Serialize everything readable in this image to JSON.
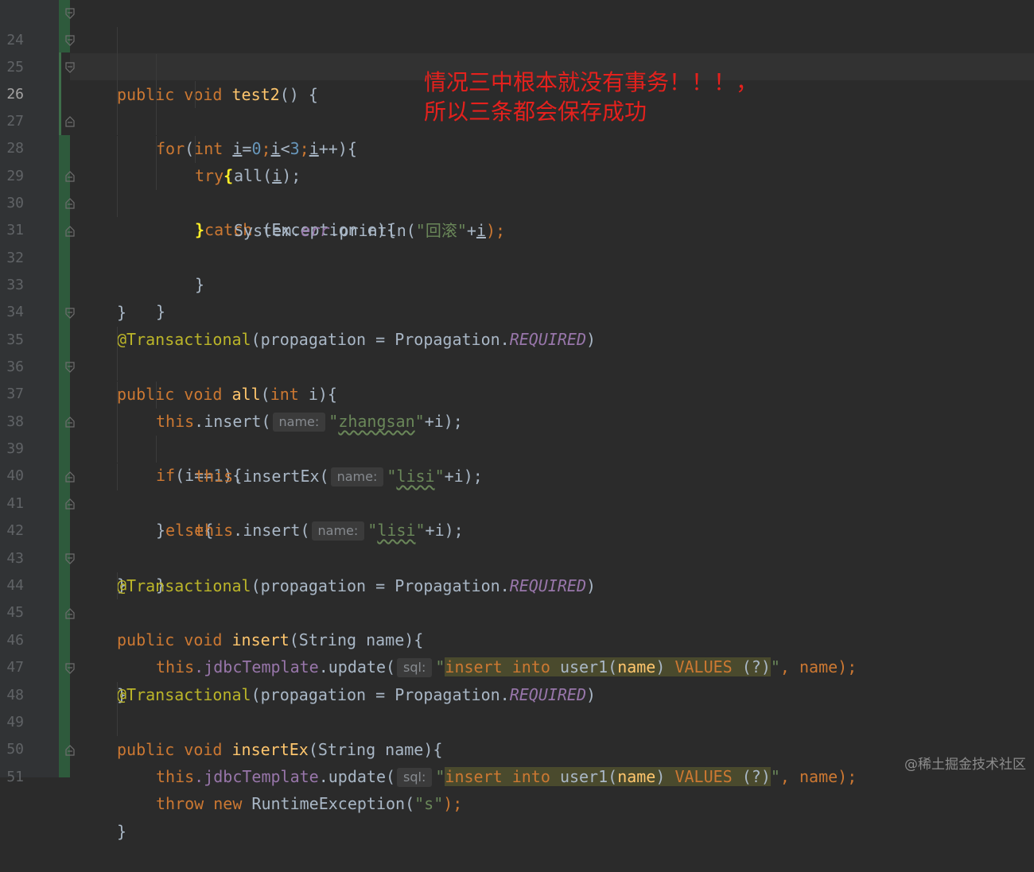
{
  "line_numbers": [
    "24",
    "25",
    "26",
    "27",
    "28",
    "29",
    "30",
    "31",
    "32",
    "33",
    "34",
    "35",
    "36",
    "37",
    "38",
    "39",
    "40",
    "41",
    "42",
    "43",
    "44",
    "45",
    "46",
    "47",
    "48",
    "49",
    "50",
    "51"
  ],
  "code": {
    "l24": {
      "public": "public",
      "void": "void",
      "name": "test2",
      "rest": "() {"
    },
    "l25": {
      "for": "for",
      "open": "(",
      "int": "int",
      "i1": "i",
      "eq": "=",
      "zero": "0",
      "semi1": ";",
      "i2": "i",
      "lt": "<",
      "three": "3",
      "semi2": ";",
      "i3": "i",
      "rest": "++){"
    },
    "l26": {
      "try": "try",
      "brace": "{"
    },
    "l27": {
      "call": "all(",
      "i": "i",
      "rest": ");"
    },
    "l28": {
      "brace": "}",
      "catch": "catch",
      "rest": " (Exception e){"
    },
    "l29": {
      "sys": "System.",
      "err": "err",
      "println": ".println(",
      "str": "\"回滚\"",
      "plus": "+",
      "i": "i",
      "rest": ");"
    },
    "l30": {
      "text": "}"
    },
    "l31": {
      "text": "}"
    },
    "l32": {
      "text": "}"
    },
    "l34": {
      "ann": "@Transactional",
      "args": "(propagation = Propagation.",
      "const": "REQUIRED",
      "close": ")"
    },
    "l35": {
      "public": "public",
      "void": "void",
      "name": "all",
      "open": "(",
      "int": "int",
      "rest": " i){"
    },
    "l36": {
      "this": "this",
      "method": ".insert(",
      "hint": "name:",
      "q1": "\"",
      "val": "zhangsan",
      "q2": "\"",
      "rest": "+i);"
    },
    "l37": {
      "if": "if",
      "cond1": "(i==",
      "one": "1",
      "cond2": "){"
    },
    "l38": {
      "this": "this",
      "method": ".insertEx(",
      "hint": "name:",
      "q1": "\"",
      "val": "lisi",
      "q2": "\"",
      "rest": "+i);"
    },
    "l39": {
      "brace": "}",
      "else": "else",
      "rest": "{"
    },
    "l40": {
      "this": "this",
      "method": ".insert(",
      "hint": "name:",
      "q1": "\"",
      "val": "lisi",
      "q2": "\"",
      "rest": "+i);"
    },
    "l41": {
      "text": "}"
    },
    "l42": {
      "text": "}"
    },
    "l43": {
      "ann": "@Transactional",
      "args": "(propagation = Propagation.",
      "const": "REQUIRED",
      "close": ")"
    },
    "l44": {
      "public": "public",
      "void": "void",
      "name": "insert",
      "rest": "(String name){"
    },
    "l45": {
      "this": "this",
      "field": ".jdbcTemplate",
      "method": ".update(",
      "hint": "sql:",
      "q1": "\"",
      "sql_insert": "insert",
      "sql_into": "into",
      "sql_table": "user1(",
      "sql_col": "name",
      "sql_close": ")",
      "sql_values": "VALUES",
      "sql_param": "(?)",
      "q2": "\"",
      "rest": ", name);"
    },
    "l46": {
      "text": "}"
    },
    "l47": {
      "ann": "@Transactional",
      "args": "(propagation = Propagation.",
      "const": "REQUIRED",
      "close": ")"
    },
    "l48": {
      "public": "public",
      "void": "void",
      "name": "insertEx",
      "rest": "(String name){"
    },
    "l49": {
      "this": "this",
      "field": ".jdbcTemplate",
      "method": ".update(",
      "hint": "sql:",
      "q1": "\"",
      "sql_insert": "insert",
      "sql_into": "into",
      "sql_table": "user1(",
      "sql_col": "name",
      "sql_close": ")",
      "sql_values": "VALUES",
      "sql_param": "(?)",
      "q2": "\"",
      "rest": ", name);"
    },
    "l50": {
      "throw": "throw",
      "new": "new",
      "rest": " RuntimeException(",
      "str": "\"s\"",
      "close": ");"
    },
    "l51": {
      "text": "}"
    }
  },
  "annotation_note": {
    "line1": "情况三中根本就没有事务！！！，",
    "line2": "所以三条都会保存成功"
  },
  "watermark": "@稀土掘金技术社区",
  "colors": {
    "keyword": "#cc7832",
    "method": "#ffc66d",
    "number": "#6897bb",
    "string": "#6a8759",
    "annotation": "#bbb529",
    "constant": "#9876aa",
    "note": "#e5211d"
  }
}
